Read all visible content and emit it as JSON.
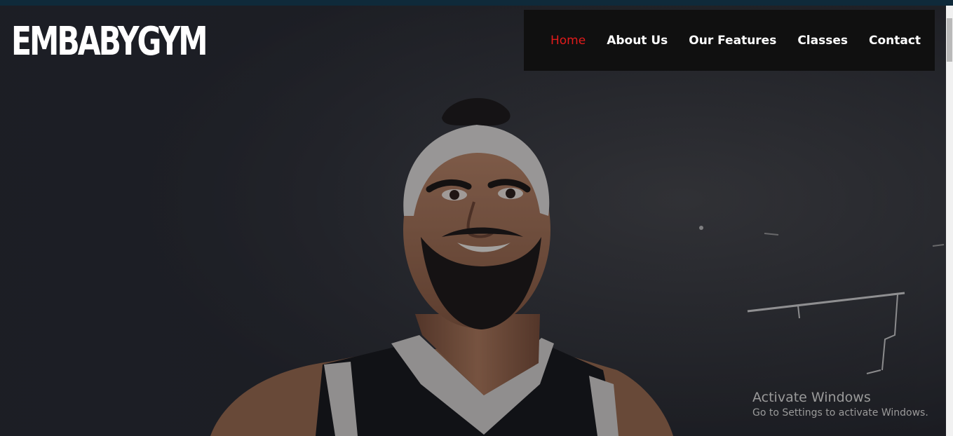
{
  "brand": {
    "logo_text": "EMBABYGYM"
  },
  "nav": {
    "items": [
      {
        "label": "Home",
        "active": true
      },
      {
        "label": "About Us",
        "active": false
      },
      {
        "label": "Our Features",
        "active": false
      },
      {
        "label": "Classes",
        "active": false
      },
      {
        "label": "Contact",
        "active": false
      }
    ]
  },
  "hero": {
    "image_subject": "smiling bearded athlete in headband and black tank top against dark chalk wall"
  },
  "watermark": {
    "title": "Activate Windows",
    "subtitle": "Go to Settings to activate Windows."
  },
  "colors": {
    "accent": "#e11b1b",
    "nav_bg": "#101010",
    "top_strip": "#0f2a3a"
  }
}
